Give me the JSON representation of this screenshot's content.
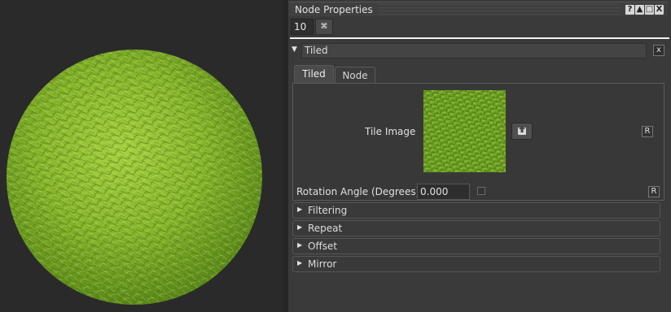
{
  "panel": {
    "title": "Node Properties",
    "header_buttons": [
      "?",
      "▲",
      "□",
      "X"
    ],
    "level_value": "10",
    "pin_label": "⌘"
  },
  "node": {
    "name": "Tiled",
    "close_label": "x"
  },
  "tabs": [
    {
      "label": "Tiled",
      "active": true
    },
    {
      "label": "Node",
      "active": false
    }
  ],
  "properties": {
    "tile_image": {
      "label": "Tile Image",
      "reset_label": "R"
    },
    "rotation": {
      "label": "Rotation Angle (Degrees)",
      "value": "0.000",
      "reset_label": "R",
      "checked": false
    }
  },
  "sections": [
    {
      "label": "Filtering"
    },
    {
      "label": "Repeat"
    },
    {
      "label": "Offset"
    },
    {
      "label": "Mirror"
    }
  ],
  "colors": {
    "grass_dark": "#5a8a1a",
    "grass_light": "#9ccc3c",
    "panel_bg": "#3a3a3a"
  },
  "icons": {
    "collapse": "triangle-down-icon",
    "section": "triangle-right-icon",
    "browse": "folder-upload-icon"
  }
}
